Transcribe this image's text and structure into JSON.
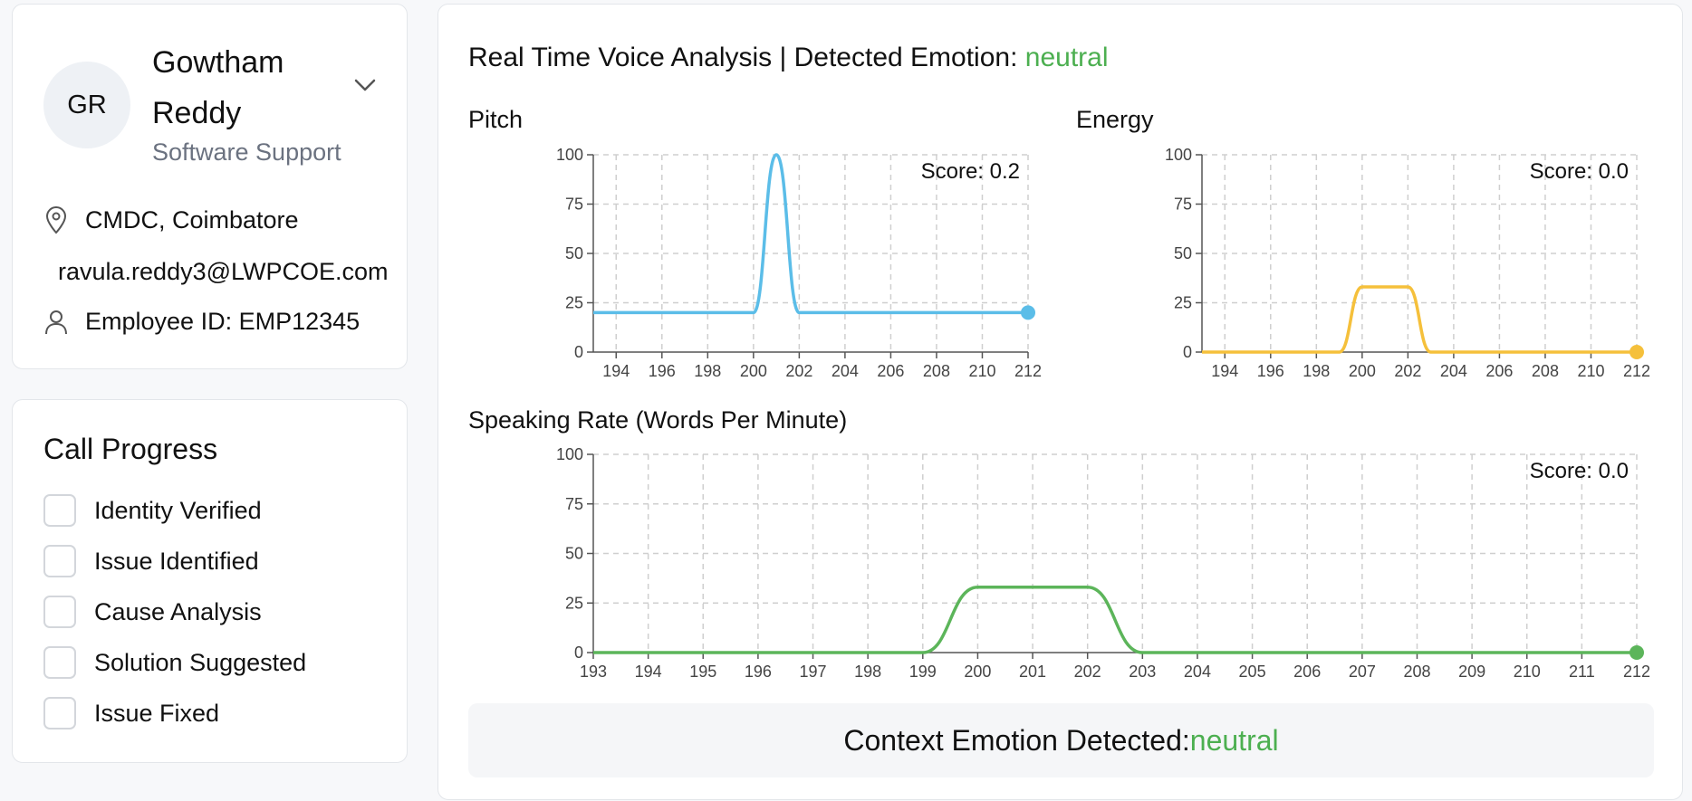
{
  "profile": {
    "initials": "GR",
    "name": "Gowtham Reddy",
    "role": "Software Support",
    "location": "CMDC, Coimbatore",
    "email": "ravula.reddy3@LWPCOE.com",
    "employee_id": "Employee ID: EMP12345"
  },
  "call_progress": {
    "title": "Call Progress",
    "items": [
      {
        "label": "Identity Verified",
        "checked": false
      },
      {
        "label": "Issue Identified",
        "checked": false
      },
      {
        "label": "Cause Analysis",
        "checked": false
      },
      {
        "label": "Solution Suggested",
        "checked": false
      },
      {
        "label": "Issue Fixed",
        "checked": false
      }
    ]
  },
  "analysis": {
    "title_prefix": "Real Time Voice Analysis | Detected Emotion: ",
    "emotion": "neutral",
    "context_prefix": "Context Emotion Detected: ",
    "context_emotion": "neutral"
  },
  "colors": {
    "pitch": "#5bbde8",
    "energy": "#f5c03b",
    "rate": "#5cb55a",
    "emotion_text": "#4caf50"
  },
  "chart_data": [
    {
      "type": "line",
      "title": "Pitch",
      "score_label": "Score: 0.2",
      "x_ticks": [
        194,
        196,
        198,
        200,
        202,
        204,
        206,
        208,
        210,
        212
      ],
      "xlim": [
        193,
        212
      ],
      "ylim": [
        0,
        100
      ],
      "y_ticks": [
        0,
        25,
        50,
        75,
        100
      ],
      "grid": true,
      "series": [
        {
          "x": [
            193,
            194,
            196,
            198,
            200,
            201,
            202,
            204,
            206,
            208,
            210,
            212
          ],
          "y": [
            20,
            20,
            20,
            20,
            20,
            100,
            20,
            20,
            20,
            20,
            20,
            20
          ]
        }
      ]
    },
    {
      "type": "line",
      "title": "Energy",
      "score_label": "Score: 0.0",
      "x_ticks": [
        194,
        196,
        198,
        200,
        202,
        204,
        206,
        208,
        210,
        212
      ],
      "xlim": [
        193,
        212
      ],
      "ylim": [
        0,
        100
      ],
      "y_ticks": [
        0,
        25,
        50,
        75,
        100
      ],
      "grid": true,
      "series": [
        {
          "x": [
            193,
            194,
            196,
            198,
            199,
            200,
            201,
            202,
            203,
            204,
            206,
            208,
            210,
            212
          ],
          "y": [
            0,
            0,
            0,
            0,
            0,
            33,
            33,
            33,
            0,
            0,
            0,
            0,
            0,
            0
          ]
        }
      ]
    },
    {
      "type": "line",
      "title": "Speaking Rate (Words Per Minute)",
      "score_label": "Score: 0.0",
      "x_ticks": [
        193,
        194,
        195,
        196,
        197,
        198,
        199,
        200,
        201,
        202,
        203,
        204,
        205,
        206,
        207,
        208,
        209,
        210,
        211,
        212
      ],
      "xlim": [
        193,
        212
      ],
      "ylim": [
        0,
        100
      ],
      "y_ticks": [
        0,
        25,
        50,
        75,
        100
      ],
      "grid": true,
      "series": [
        {
          "x": [
            193,
            194,
            195,
            196,
            197,
            198,
            199,
            200,
            201,
            202,
            203,
            204,
            205,
            206,
            207,
            208,
            209,
            210,
            211,
            212
          ],
          "y": [
            0,
            0,
            0,
            0,
            0,
            0,
            0,
            33,
            33,
            33,
            0,
            0,
            0,
            0,
            0,
            0,
            0,
            0,
            0,
            0
          ]
        }
      ]
    }
  ]
}
